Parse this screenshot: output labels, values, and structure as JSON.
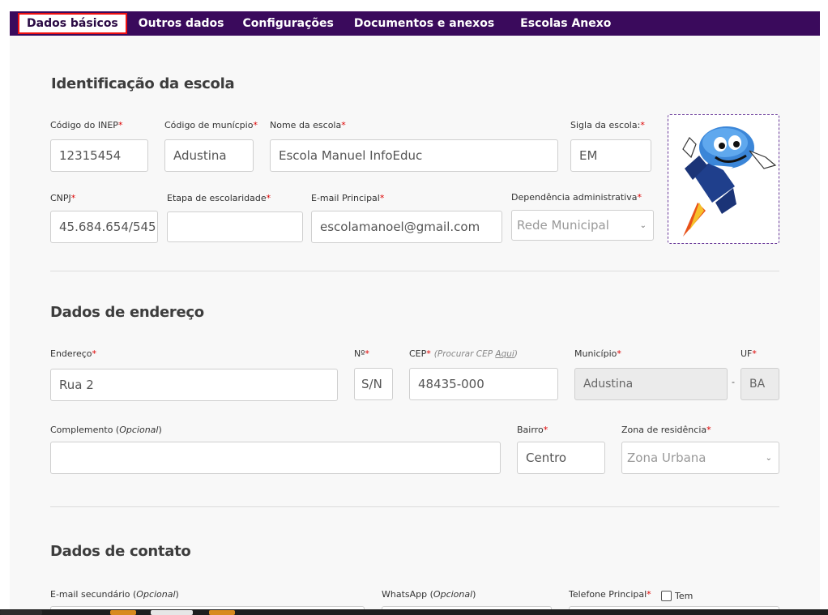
{
  "tabs": [
    {
      "label": "Dados básicos",
      "active": true
    },
    {
      "label": "Outros dados"
    },
    {
      "label": "Configurações"
    },
    {
      "label": "Documentos e anexos"
    },
    {
      "label": "Escolas Anexo"
    }
  ],
  "identificacao": {
    "title": "Identificação da escola",
    "codigo_inep": {
      "label": "Código do INEP",
      "value": "12315454"
    },
    "codigo_municipio": {
      "label": "Código de munícpio",
      "value": "Adustina"
    },
    "nome_escola": {
      "label": "Nome da escola",
      "value": "Escola Manuel InfoEduc"
    },
    "sigla": {
      "label": "Sigla da escola:",
      "value": "EM"
    },
    "cnpj": {
      "label": "CNPJ",
      "value": "45.684.654/545"
    },
    "etapa": {
      "label": "Etapa de escolaridade",
      "value": ""
    },
    "email_principal": {
      "label": "E-mail Principal",
      "value": "escolamanoel@gmail.com"
    },
    "dependencia": {
      "label": "Dependência administrativa",
      "value": "Rede Municipal"
    }
  },
  "endereco": {
    "title": "Dados de endereço",
    "endereco": {
      "label": "Endereço",
      "value": "Rua 2"
    },
    "numero": {
      "label": "Nº",
      "value": "S/N"
    },
    "cep": {
      "label": "CEP",
      "hint_prefix": "(Procurar CEP ",
      "hint_link": "Aqui",
      "hint_suffix": ")",
      "value": "48435-000"
    },
    "municipio": {
      "label": "Município",
      "value": "Adustina"
    },
    "dash": "-",
    "uf": {
      "label": "UF",
      "value": "BA"
    },
    "complemento": {
      "label": "Complemento (",
      "opt": "Opcional",
      "close": ")",
      "value": ""
    },
    "bairro": {
      "label": "Bairro",
      "value": "Centro"
    },
    "zona": {
      "label": "Zona de residência",
      "value": "Zona Urbana"
    }
  },
  "contato": {
    "title": "Dados de contato",
    "email_secundario": {
      "label": "E-mail secundário (",
      "opt": "Opcional",
      "close": ")"
    },
    "whatsapp": {
      "label": "WhatsApp (",
      "opt": "Opcional",
      "close": ")"
    },
    "telefone": {
      "label": "Telefone Principal",
      "check_label": "Tem"
    }
  },
  "required_mark": "*",
  "colors": {
    "navbar": "#3a0a5c",
    "active_border": "#e11111",
    "required": "#dd0000"
  }
}
